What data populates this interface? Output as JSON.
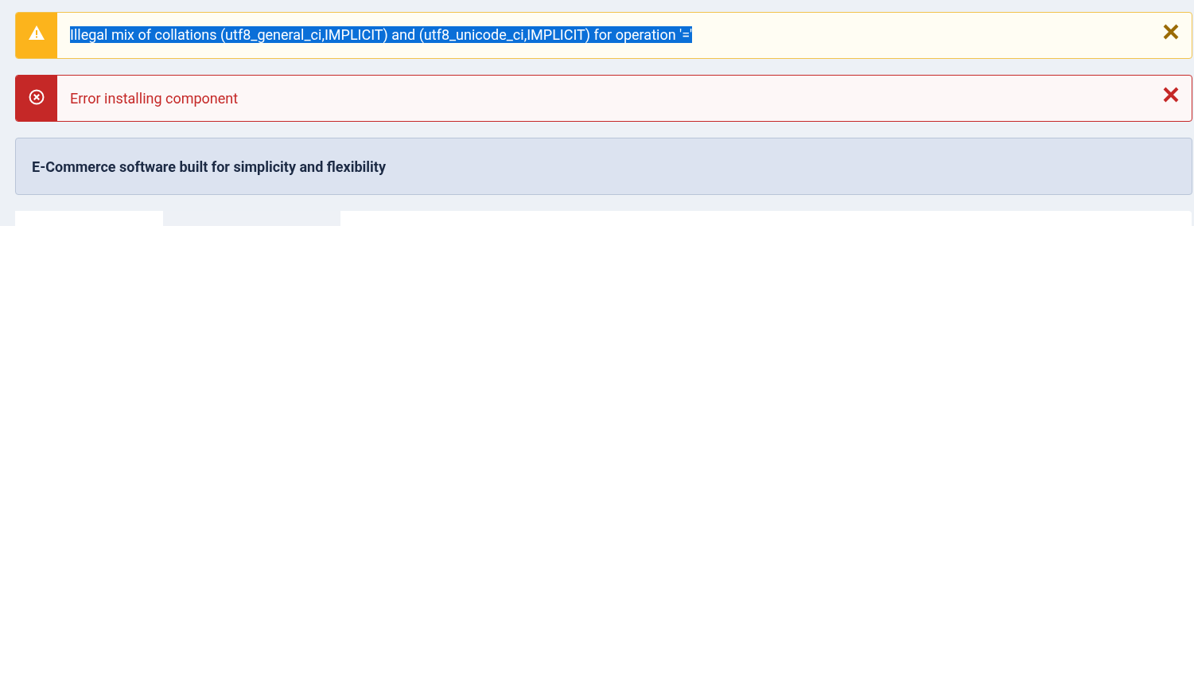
{
  "alerts": [
    {
      "kind": "warning",
      "message": "Illegal mix of collations (utf8_general_ci,IMPLICIT) and (utf8_unicode_ci,IMPLICIT) for operation '='",
      "text_selected": true,
      "dismissible": true
    },
    {
      "kind": "error",
      "message": "Error installing component",
      "text_selected": false,
      "dismissible": true
    },
    {
      "kind": "info",
      "message": "E-Commerce software built for simplicity and flexibility",
      "text_selected": false,
      "dismissible": false
    }
  ],
  "tabs": [
    {
      "selected": true
    },
    {
      "selected": false
    }
  ]
}
